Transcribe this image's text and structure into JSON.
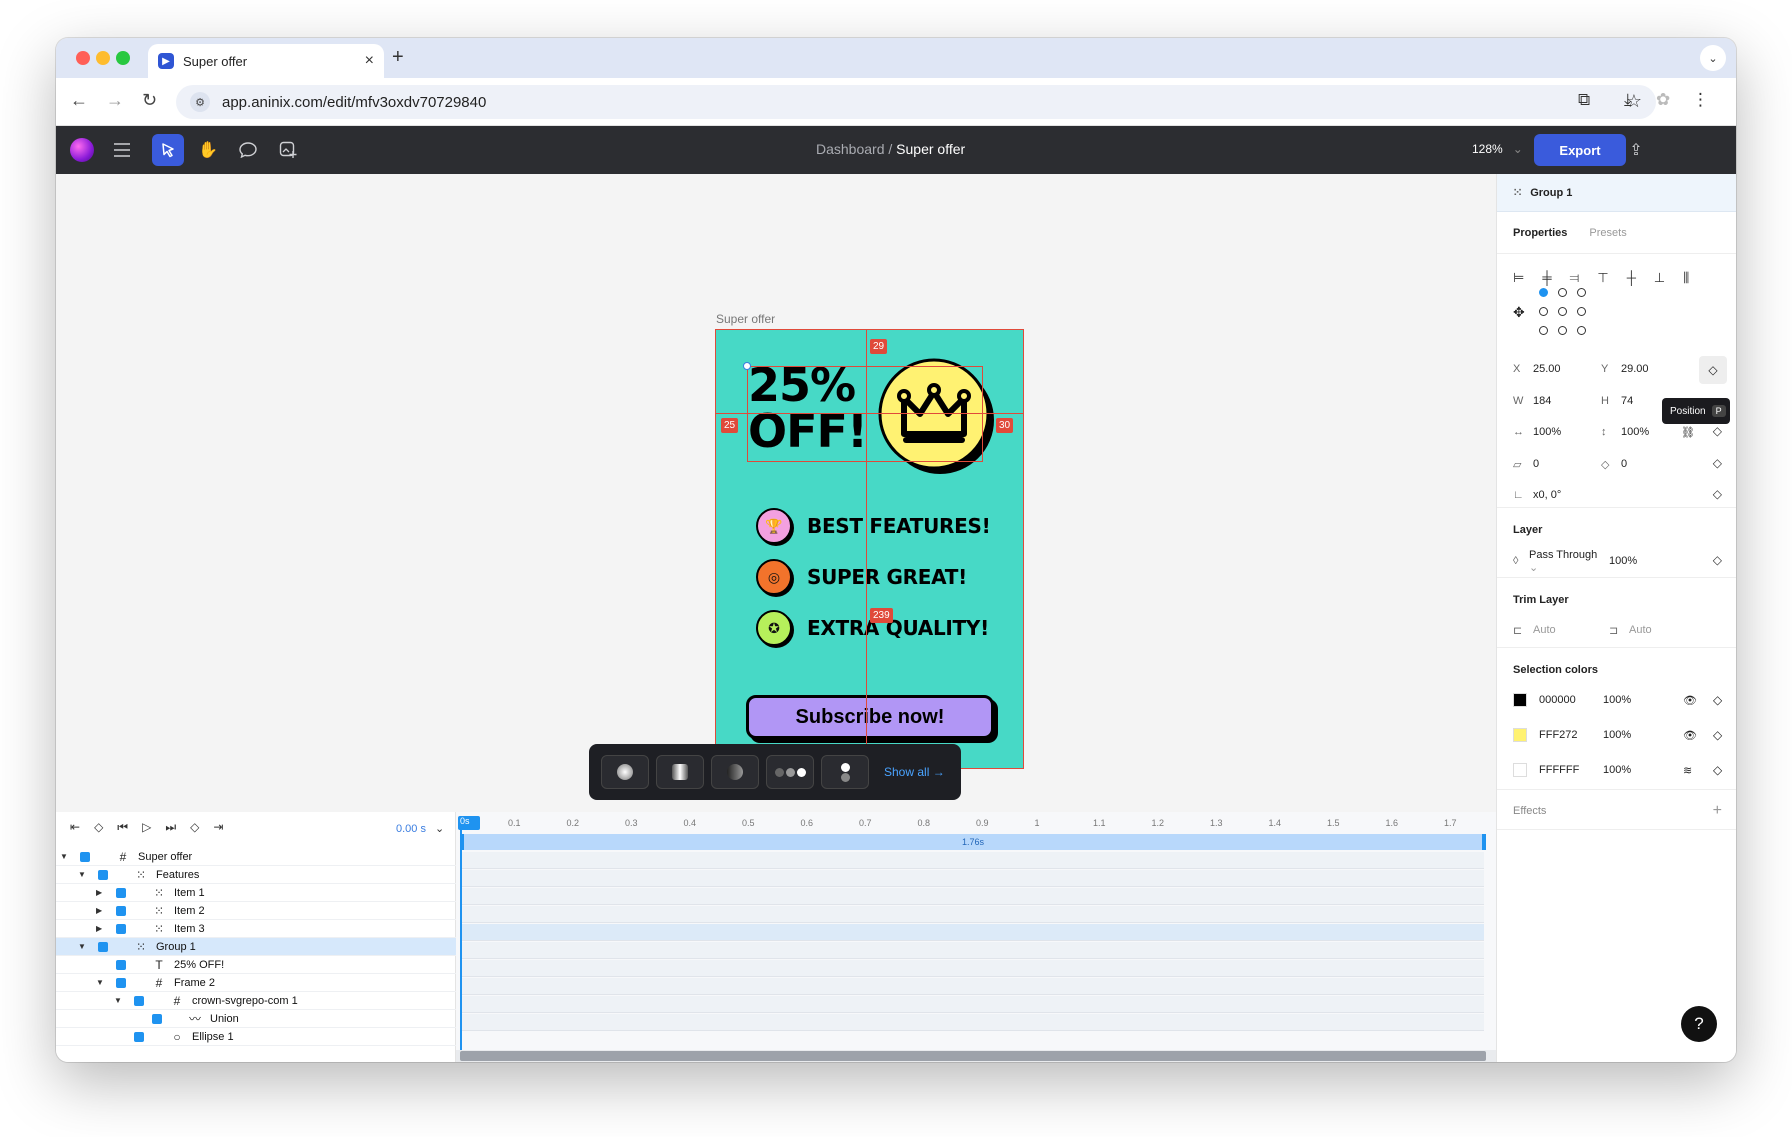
{
  "browser": {
    "tab_title": "Super offer",
    "url": "app.aninix.com/edit/mfv3oxdv70729840"
  },
  "toolbar": {
    "breadcrumb_parent": "Dashboard",
    "breadcrumb_sep": " / ",
    "breadcrumb_current": "Super offer",
    "zoom": "128%",
    "export_label": "Export"
  },
  "canvas": {
    "frame_label": "Super offer",
    "headline_1": "25%",
    "headline_2": "OFF!",
    "features": [
      {
        "label": "BEST FEATURES!",
        "color": "#f3a0e0"
      },
      {
        "label": "SUPER GREAT!",
        "color": "#f2732b"
      },
      {
        "label": "EXTRA QUALITY!",
        "color": "#b6f05b"
      }
    ],
    "cta": "Subscribe now!",
    "guides": {
      "top": "29",
      "left": "25",
      "right": "30",
      "bottom": "239"
    },
    "frame_bg": "#47D9C6",
    "crown_fill": "#FFF272"
  },
  "float_toolbar": {
    "show_all": "Show all →"
  },
  "timeline": {
    "time": "0.00 s",
    "playhead": "0s",
    "duration": "1.76s",
    "ruler": [
      "0.1",
      "0.2",
      "0.3",
      "0.4",
      "0.5",
      "0.6",
      "0.7",
      "0.8",
      "0.9",
      "1",
      "1.1",
      "1.2",
      "1.3",
      "1.4",
      "1.5",
      "1.6",
      "1.7"
    ],
    "layers": [
      {
        "name": "Super offer",
        "icon": "#",
        "indent": 0,
        "chev": "▼",
        "selected": false
      },
      {
        "name": "Features",
        "icon": "⁙",
        "indent": 1,
        "chev": "▼",
        "selected": false
      },
      {
        "name": "Item 1",
        "icon": "⁙",
        "indent": 2,
        "chev": "▶",
        "selected": false
      },
      {
        "name": "Item 2",
        "icon": "⁙",
        "indent": 2,
        "chev": "▶",
        "selected": false
      },
      {
        "name": "Item 3",
        "icon": "⁙",
        "indent": 2,
        "chev": "▶",
        "selected": false
      },
      {
        "name": "Group 1",
        "icon": "⁙",
        "indent": 1,
        "chev": "▼",
        "selected": true
      },
      {
        "name": "25% OFF!",
        "icon": "T",
        "indent": 2,
        "chev": "",
        "selected": false
      },
      {
        "name": "Frame 2",
        "icon": "#",
        "indent": 2,
        "chev": "▼",
        "selected": false
      },
      {
        "name": "crown-svgrepo-com 1",
        "icon": "#",
        "indent": 3,
        "chev": "▼",
        "selected": false
      },
      {
        "name": "Union",
        "icon": "〰",
        "indent": 4,
        "chev": "",
        "selected": false
      },
      {
        "name": "Ellipse 1",
        "icon": "○",
        "indent": 3,
        "chev": "",
        "selected": false
      }
    ]
  },
  "props": {
    "header": "Group 1",
    "tab_properties": "Properties",
    "tab_presets": "Presets",
    "x_label": "X",
    "x": "25.00",
    "y_label": "Y",
    "y": "29.00",
    "w_label": "W",
    "w": "184",
    "h_label": "H",
    "h": "74",
    "scale_x": "100%",
    "scale_y": "100%",
    "skew": "0",
    "radius": "0",
    "rotation": "x0, 0°",
    "tooltip": "Position",
    "tooltip_key": "P",
    "layer_title": "Layer",
    "blend": "Pass Through",
    "opacity": "100%",
    "trim_title": "Trim Layer",
    "trim_start": "Auto",
    "trim_end": "Auto",
    "colors_title": "Selection colors",
    "colors": [
      {
        "hex": "000000",
        "pct": "100%",
        "swatch": "#000000",
        "eye": "👁"
      },
      {
        "hex": "FFF272",
        "pct": "100%",
        "swatch": "#FFF272",
        "eye": "👁"
      },
      {
        "hex": "FFFFFF",
        "pct": "100%",
        "swatch": "#FFFFFF",
        "eye": "≋"
      }
    ],
    "effects_title": "Effects",
    "help": "?"
  }
}
